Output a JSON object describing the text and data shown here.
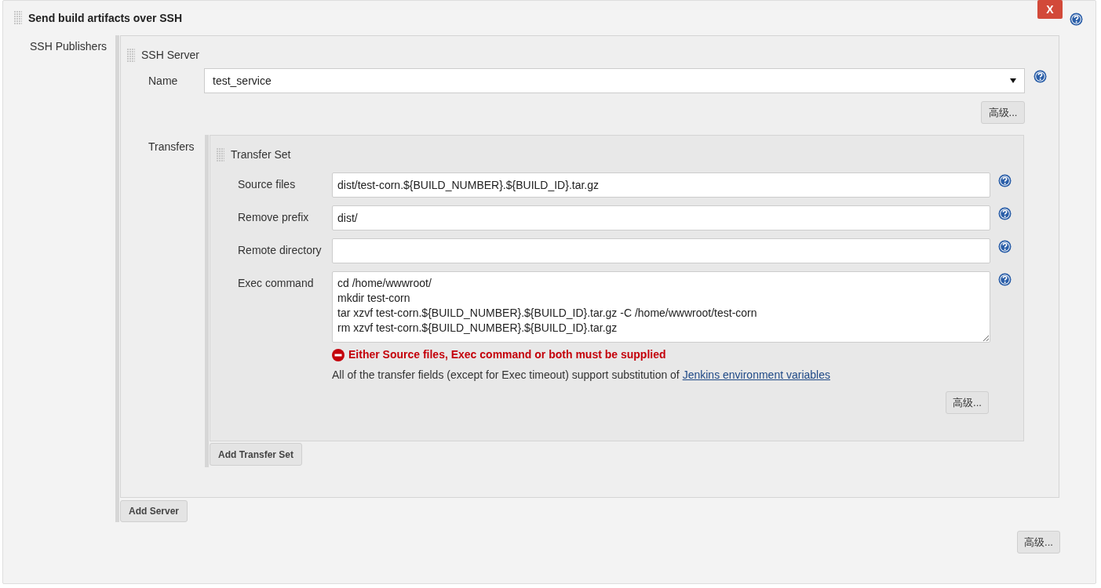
{
  "section": {
    "title": "Send build artifacts over SSH",
    "close_label": "X"
  },
  "publishers_label": "SSH Publishers",
  "server": {
    "title": "SSH Server",
    "name_label": "Name",
    "name_value": "test_service",
    "advanced_button": "高级...",
    "transfers_label": "Transfers",
    "transfer_set": {
      "title": "Transfer Set",
      "fields": [
        {
          "label": "Source files",
          "kind": "text",
          "value": "dist/test-corn.${BUILD_NUMBER}.${BUILD_ID}.tar.gz"
        },
        {
          "label": "Remove prefix",
          "kind": "text",
          "value": "dist/"
        },
        {
          "label": "Remote directory",
          "kind": "text"
        },
        {
          "label": "Exec command",
          "kind": "textarea",
          "value": "cd /home/wwwroot/\nmkdir test-corn\ntar xzvf test-corn.${BUILD_NUMBER}.${BUILD_ID}.tar.gz -C /home/wwwroot/test-corn\nrm xzvf test-corn.${BUILD_NUMBER}.${BUILD_ID}.tar.gz"
        }
      ],
      "error": "Either Source files, Exec command or both must be supplied",
      "note": "All of the transfer fields (except for Exec timeout) support substitution of",
      "note_link": "Jenkins environment variables",
      "advanced_button": "高级..."
    },
    "add_transfer_button": "Add Transfer Set"
  },
  "add_server_button": "Add Server",
  "advanced_button": "高级..."
}
